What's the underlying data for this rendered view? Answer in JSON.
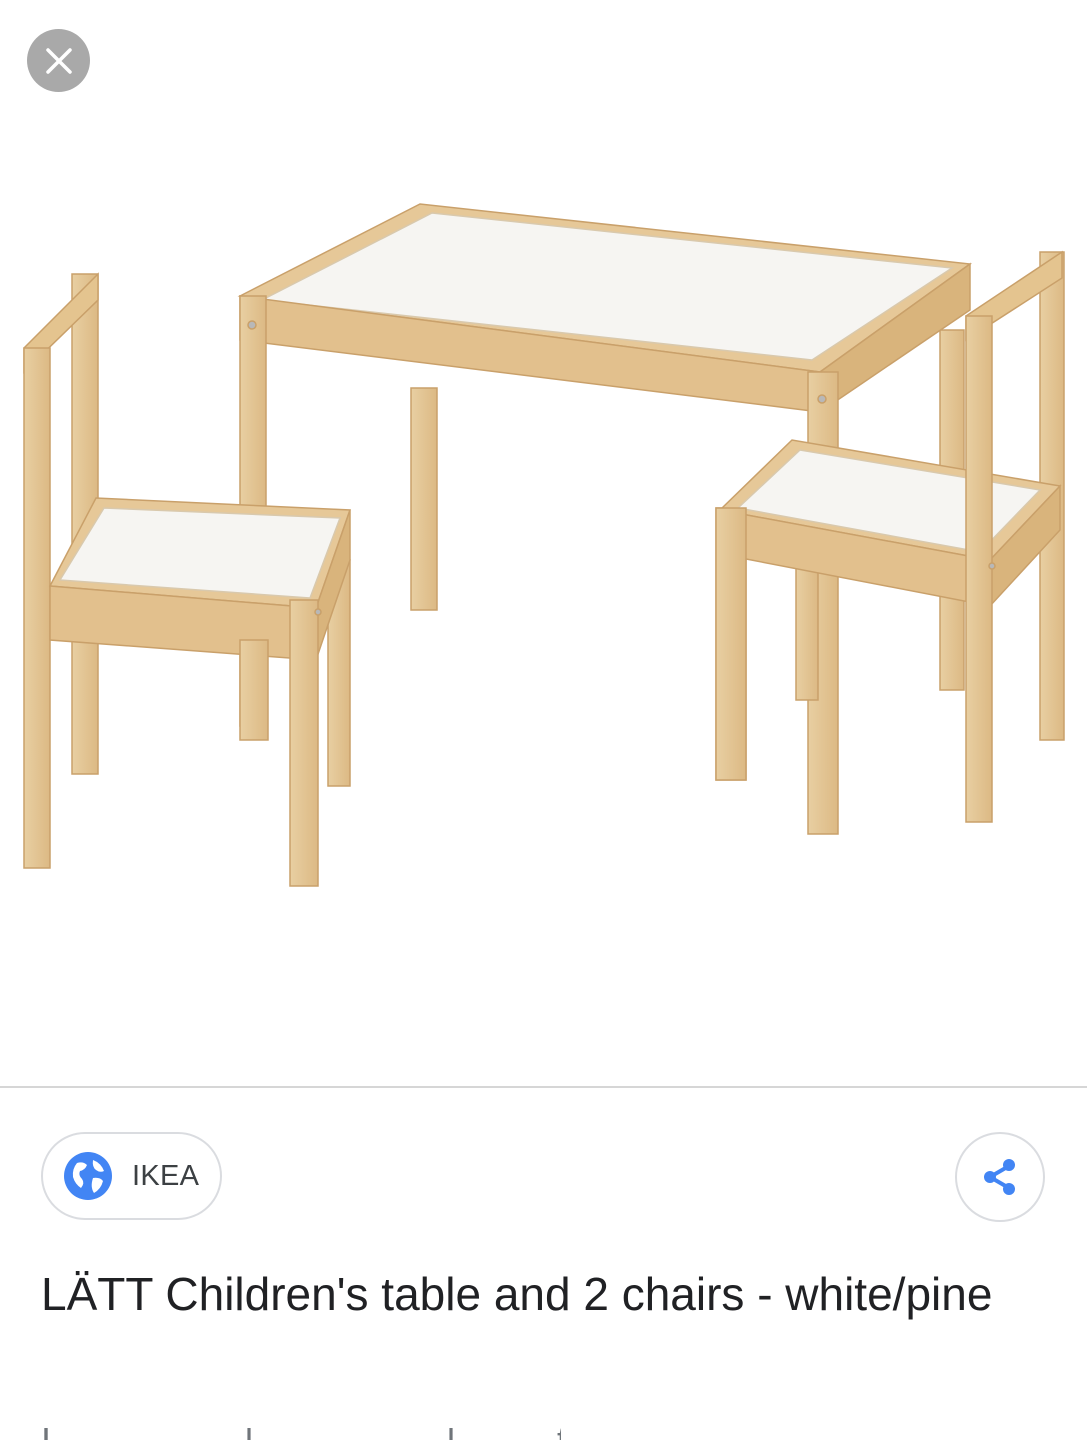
{
  "viewer": {
    "close_label": "Close"
  },
  "result": {
    "source": "IKEA",
    "title": "LÄTT Children's table and 2 chairs - white/pine",
    "snippet_partial": "I … … … … l … … … … l … … t … … … … l … l … …"
  },
  "colors": {
    "pine": "#e3c596",
    "pine_dark": "#cfa56f",
    "white_top": "#f5f4f1",
    "globe_blue": "#4285f4",
    "share_blue": "#4285f4"
  },
  "icons": {
    "close": "close-icon",
    "source": "globe-icon",
    "share": "share-icon"
  }
}
